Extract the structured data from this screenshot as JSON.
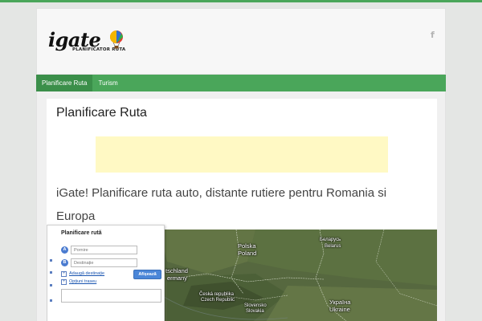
{
  "header": {
    "logo_text": "igate",
    "logo_subtitle": "PLANIFICATOR RUTA",
    "social_icon": "facebook-icon",
    "social_glyph": "f"
  },
  "nav": {
    "items": [
      {
        "label": "Planificare Ruta",
        "active": true
      },
      {
        "label": "Turism",
        "active": false
      }
    ]
  },
  "main": {
    "title": "Planificare Ruta",
    "lead": "iGate! Planificare ruta auto, distante rutiere pentru Romania si Europa"
  },
  "planner": {
    "title": "Planificare rută",
    "start_marker": "A",
    "end_marker": "B",
    "start_placeholder": "Pornire",
    "destination_placeholder": "Destinație",
    "add_destination_label": "Adaugă destinație",
    "route_options_label": "Opțiuni traseu",
    "submit_label": "Afișează"
  },
  "map": {
    "labels": {
      "polska": "Polska",
      "poland": "Poland",
      "belarus_local": "Беларусь",
      "belarus": "Belarus",
      "deutschland": "tschland",
      "germany": "ermany",
      "cz_local": "Česká republika",
      "cz": "Czech Republic",
      "sk_local": "Slovensko",
      "sk": "Slovakia",
      "ua_local": "Україна",
      "ua": "Ukraine"
    }
  },
  "colors": {
    "accent_green": "#4aa65a",
    "nav_active": "#3b8f4a",
    "ad_background": "#fff9c4",
    "button_blue": "#4a86d8"
  }
}
